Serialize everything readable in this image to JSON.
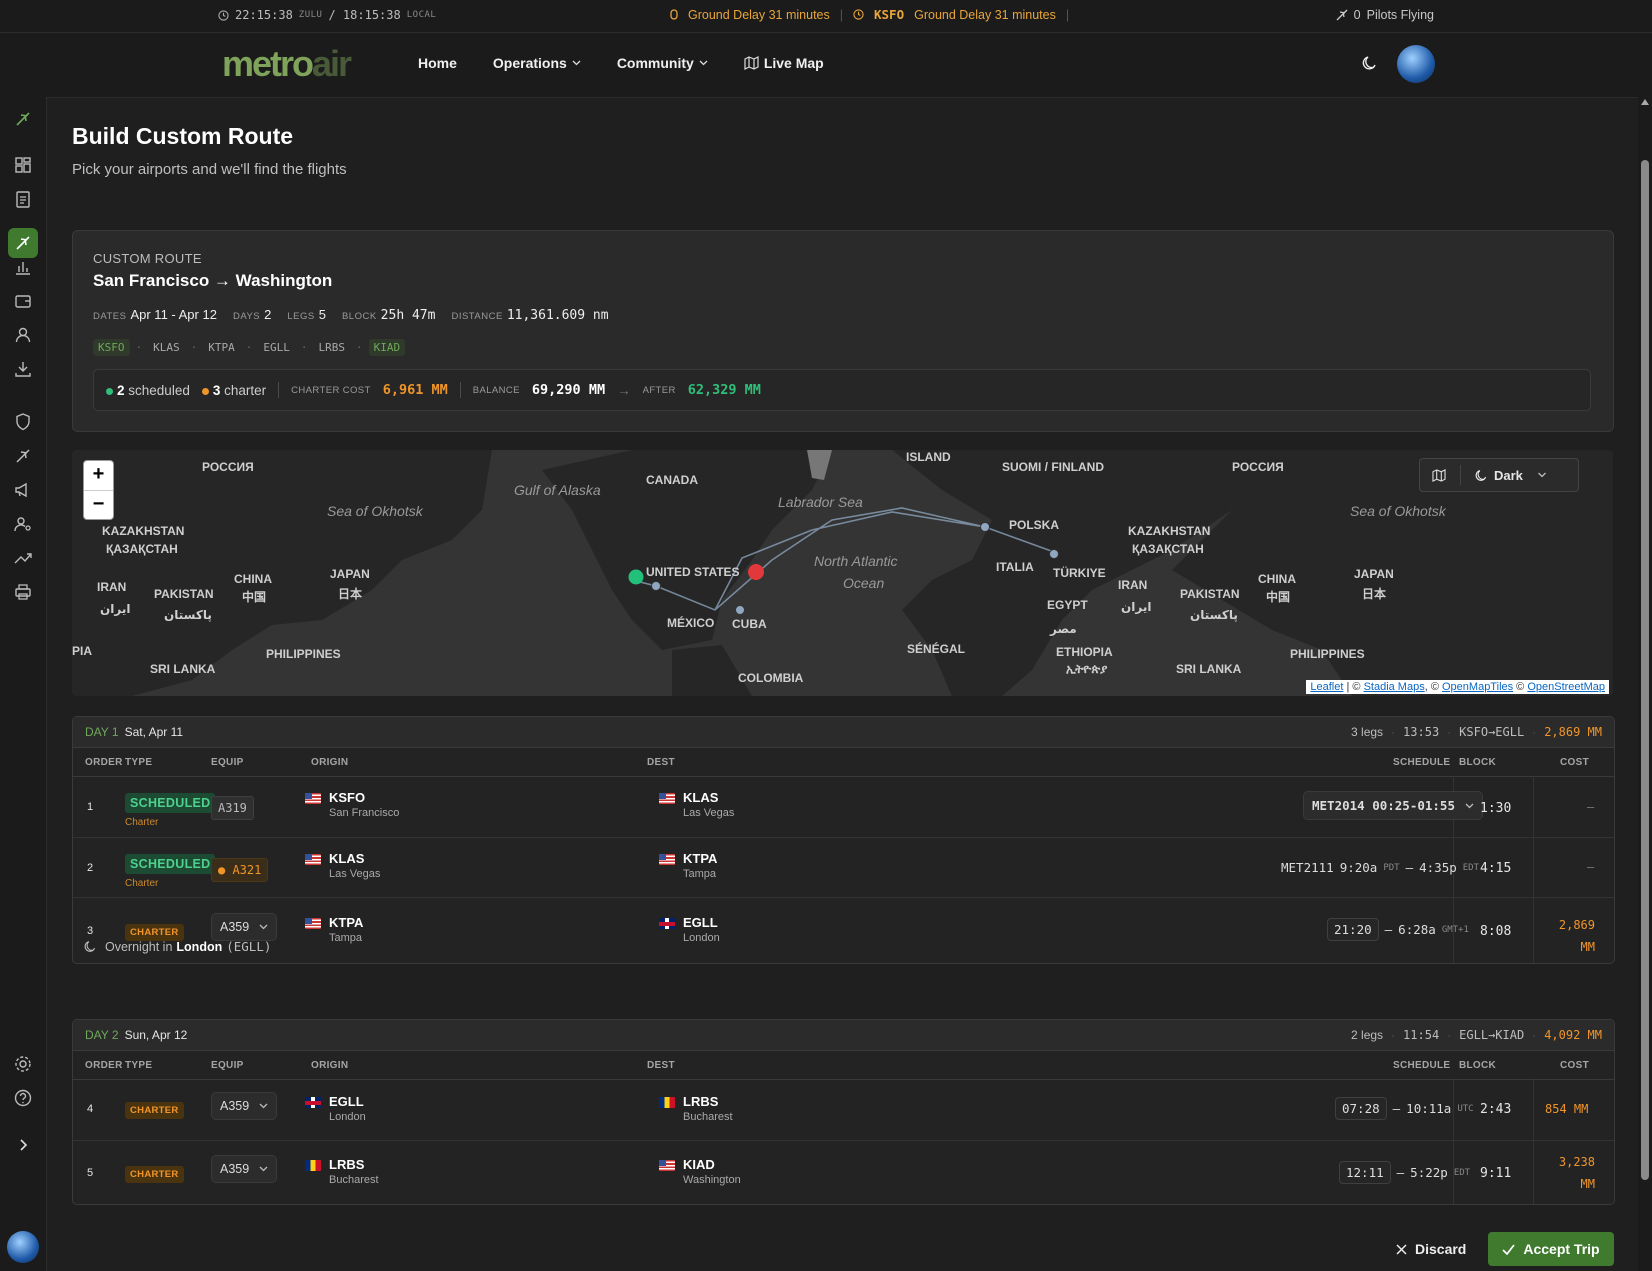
{
  "topbar": {
    "zulu_time": "22:15:38",
    "zulu_label": "ZULU",
    "local_time": "/ 18:15:38",
    "local_label": "LOCAL",
    "alert1": "Ground Delay 31 minutes",
    "alert2_code": "KSFO",
    "alert2": "Ground Delay 31 minutes",
    "pilots_count": "0",
    "pilots_label": "Pilots Flying"
  },
  "nav": {
    "logo_metro": "metro",
    "logo_air": "air",
    "home": "Home",
    "operations": "Operations",
    "community": "Community",
    "live_map": "Live Map"
  },
  "page": {
    "title": "Build Custom Route",
    "subtitle": "Pick your airports and we'll find the flights"
  },
  "summary": {
    "kicker": "CUSTOM ROUTE",
    "route": "San Francisco → Washington",
    "dates_label": "DATES",
    "dates": "Apr 11 - Apr 12",
    "days_label": "DAYS",
    "days": "2",
    "legs_label": "LEGS",
    "legs": "5",
    "block_label": "BLOCK",
    "block": "25h 47m",
    "distance_label": "DISTANCE",
    "distance": "11,361.609 nm",
    "chips": [
      "KSFO",
      "KLAS",
      "KTPA",
      "EGLL",
      "LRBS",
      "KIAD"
    ],
    "scheduled_count": "2",
    "scheduled_label": "scheduled",
    "charter_count": "3",
    "charter_label": "charter",
    "charter_cost_label": "CHARTER COST",
    "charter_cost": "6,961 MM",
    "balance_label": "BALANCE",
    "balance": "69,290 MM",
    "after_label": "AFTER",
    "after": "62,329 MM"
  },
  "map": {
    "style": "Dark",
    "labels": {
      "russia_l": "РОССИЯ",
      "gulf_alaska": "Gulf of Alaska",
      "canada": "CANADA",
      "island": "ISLAND",
      "suomi": "SUOMI / FINLAND",
      "russia_r": "РОССИЯ",
      "okhotsk_l": "Sea of Okhotsk",
      "labrador": "Labrador Sea",
      "polska": "POLSKA",
      "kaz_l": "KAZAKHSTAN",
      "kaz_l2": "ҚАЗАҚСТАН",
      "kaz_r": "KAZAKHSTAN",
      "kaz_r2": "ҚАЗАҚСТАН",
      "okhotsk_r": "Sea of Okhotsk",
      "china_l": "CHINA",
      "china_l2": "中国",
      "japan_l": "JAPAN",
      "japan_l2": "日本",
      "us": "UNITED STATES",
      "nao1": "North Atlantic",
      "nao2": "Ocean",
      "italia": "ITALIA",
      "turkiye": "TÜRKIYE",
      "iran_l": "IRAN",
      "iran_l2": "ایران",
      "pakistan_l": "PAKISTAN",
      "pakistan_l2": "پاکستان",
      "iran_r": "IRAN",
      "iran_r2": "ایران",
      "pakistan_r": "PAKISTAN",
      "pakistan_r2": "پاکستان",
      "china_r": "CHINA",
      "china_r2": "中国",
      "japan_r": "JAPAN",
      "japan_r2": "日本",
      "mexico": "MÉXICO",
      "cuba": "CUBA",
      "egypt": "EGYPT",
      "egypt2": "مصر",
      "senegal": "SÉNÉGAL",
      "ethiopia": "ETHIOPIA",
      "ethiopia2": "ኢትዮጵያ",
      "srilanka_l": "SRI LANKA",
      "philippines_l": "PHILIPPINES",
      "srilanka_r": "SRI LANKA",
      "philippines_r": "PHILIPPINES",
      "colombia": "COLOMBIA",
      "pia": "PIA"
    },
    "attribution": {
      "leaflet": "Leaflet",
      "sep1": " | © ",
      "stadia": "Stadia Maps",
      "sep2": ", © ",
      "omt": "OpenMapTiles",
      "sep3": " © ",
      "osm": "OpenStreetMap"
    }
  },
  "table_headers": {
    "order": "ORDER",
    "type": "TYPE",
    "equip": "EQUIP",
    "origin": "ORIGIN",
    "dest": "DEST",
    "schedule": "SCHEDULE",
    "block": "BLOCK",
    "cost": "COST"
  },
  "day1": {
    "label": "DAY 1",
    "date": "Sat, Apr 11",
    "legs": "3 legs",
    "time": "13:53",
    "route": "KSFO→EGLL",
    "cost": "2,869 MM",
    "rows": [
      {
        "order": "1",
        "type": "SCHEDULED",
        "sub": "Charter",
        "equip": "A319",
        "origin": "KSFO",
        "origin_city": "San Francisco",
        "dest": "KLAS",
        "dest_city": "Las Vegas",
        "schedule": "MET2014 00:25-01:55",
        "block": "1:30",
        "cost": "–"
      },
      {
        "order": "2",
        "type": "SCHEDULED",
        "sub": "Charter",
        "equip": "A321",
        "origin": "KLAS",
        "origin_city": "Las Vegas",
        "dest": "KTPA",
        "dest_city": "Tampa",
        "sched_flight": "MET2111",
        "sched_dep": "9:20a",
        "sched_dep_tz": "PDT",
        "sched_arr": "4:35p",
        "sched_arr_tz": "EDT",
        "block": "4:15",
        "cost": "–"
      },
      {
        "order": "3",
        "type": "CHARTER",
        "equip": "A359",
        "origin": "KTPA",
        "origin_city": "Tampa",
        "dest": "EGLL",
        "dest_city": "London",
        "dep": "21:20",
        "arr": "6:28a",
        "arr_tz": "GMT+1",
        "block": "8:08",
        "cost1": "2,869",
        "cost2": "MM"
      }
    ]
  },
  "overnight": {
    "prefix": "Overnight in",
    "city": "London",
    "code": "(EGLL)"
  },
  "day2": {
    "label": "DAY 2",
    "date": "Sun, Apr 12",
    "legs": "2 legs",
    "time": "11:54",
    "route": "EGLL→KIAD",
    "cost": "4,092 MM",
    "rows": [
      {
        "order": "4",
        "type": "CHARTER",
        "equip": "A359",
        "origin": "EGLL",
        "origin_city": "London",
        "dest": "LRBS",
        "dest_city": "Bucharest",
        "dep": "07:28",
        "arr": "10:11a",
        "arr_tz": "UTC",
        "block": "2:43",
        "cost": "854 MM"
      },
      {
        "order": "5",
        "type": "CHARTER",
        "equip": "A359",
        "origin": "LRBS",
        "origin_city": "Bucharest",
        "dest": "KIAD",
        "dest_city": "Washington",
        "dep": "12:11",
        "arr": "5:22p",
        "arr_tz": "EDT",
        "block": "9:11",
        "cost1": "3,238",
        "cost2": "MM"
      }
    ]
  },
  "actions": {
    "discard": "Discard",
    "accept": "Accept Trip"
  },
  "colors": {
    "accent_green": "#3f7a2e",
    "charter_orange": "#f0952a",
    "scheduled_green": "#4fd18d"
  }
}
